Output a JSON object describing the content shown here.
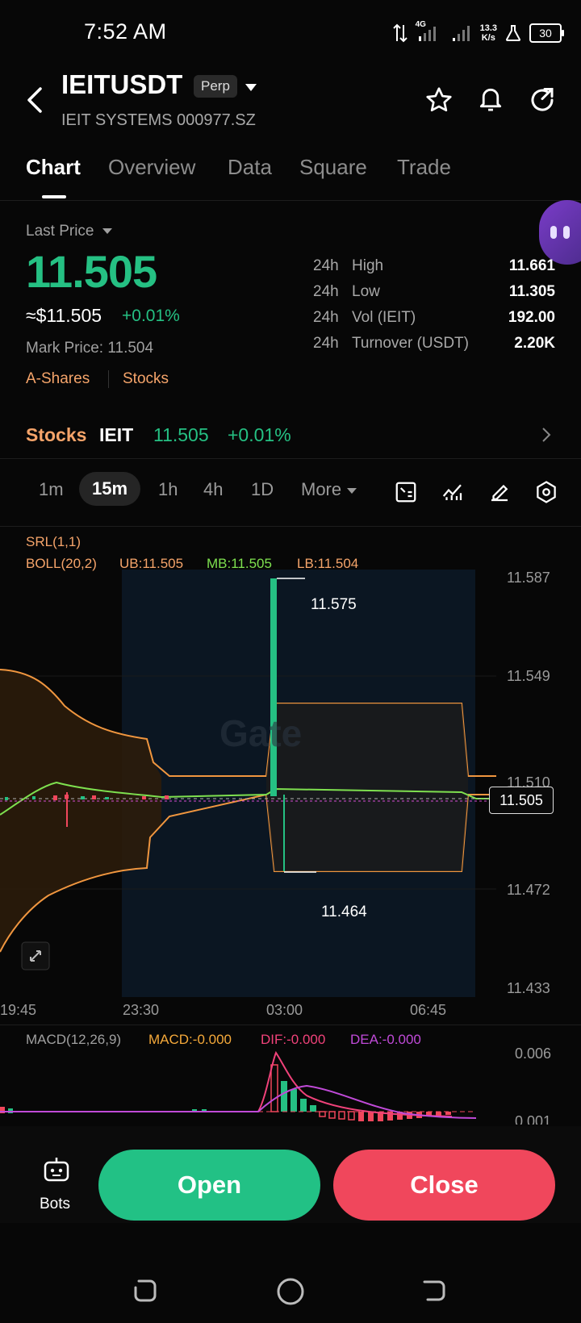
{
  "status_bar": {
    "time": "7:52 AM",
    "network": "4G",
    "speed_value": "13.3",
    "speed_unit": "K/s",
    "battery": "30"
  },
  "header": {
    "symbol": "IEITUSDT",
    "badge": "Perp",
    "subtitle": "IEIT SYSTEMS 000977.SZ"
  },
  "tabs": [
    "Chart",
    "Overview",
    "Data",
    "Square",
    "Trade"
  ],
  "price": {
    "label": "Last Price",
    "value": "11.505",
    "usd": "≈$11.505",
    "change": "+0.01%",
    "mark": "Mark Price: 11.504",
    "tags": [
      "A-Shares",
      "Stocks"
    ]
  },
  "stats": [
    {
      "period": "24h",
      "label": "High",
      "value": "11.661"
    },
    {
      "period": "24h",
      "label": "Low",
      "value": "11.305"
    },
    {
      "period": "24h",
      "label": "Vol (IEIT)",
      "value": "192.00"
    },
    {
      "period": "24h",
      "label": "Turnover (USDT)",
      "value": "2.20K"
    }
  ],
  "stock_bar": {
    "category": "Stocks",
    "ticker": "IEIT",
    "price": "11.505",
    "change": "+0.01%"
  },
  "intervals": [
    "1m",
    "15m",
    "1h",
    "4h",
    "1D",
    "More"
  ],
  "active_interval": "15m",
  "indicators": {
    "srl": "SRL(1,1)",
    "boll": "BOLL(20,2)",
    "ub": "UB:11.505",
    "mb": "MB:11.505",
    "lb": "LB:11.504",
    "macd_name": "MACD(12,26,9)",
    "macd": "MACD:-0.000",
    "dif": "DIF:-0.000",
    "dea": "DEA:-0.000"
  },
  "chart_data": {
    "type": "candlestick",
    "price_axis": [
      "11.587",
      "11.549",
      "11.510",
      "11.472",
      "11.433"
    ],
    "time_axis": [
      "19:45",
      "23:30",
      "03:00",
      "06:45"
    ],
    "current_price": "11.505",
    "high_marker": "11.575",
    "low_marker": "11.464",
    "macd_axis": [
      "0.006",
      "0.001"
    ],
    "watermark": "Gate"
  },
  "actions": {
    "bots": "Bots",
    "open": "Open",
    "close": "Close"
  },
  "colors": {
    "up": "#25c083",
    "down": "#f0475c",
    "accent": "#f5a46a"
  }
}
